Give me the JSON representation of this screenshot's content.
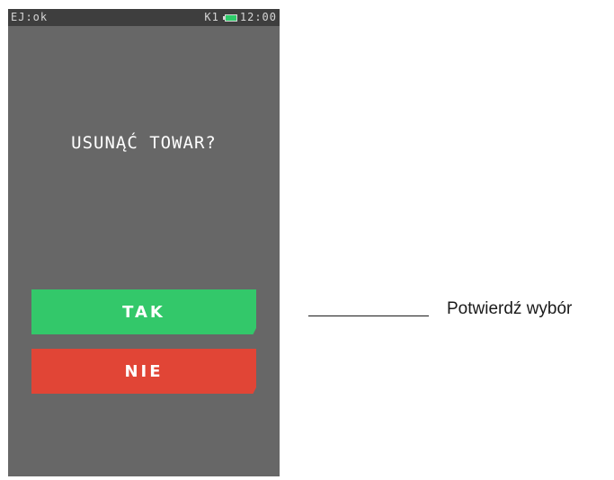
{
  "status_bar": {
    "left_text": "EJ:ok",
    "k_label": "K1",
    "battery_icon": "battery-charging-icon",
    "time": "12:00"
  },
  "dialog": {
    "question": "USUNĄĆ TOWAR?",
    "yes_label": "TAK",
    "no_label": "NIE"
  },
  "annotation": {
    "text": "Potwierdź wybór"
  },
  "colors": {
    "screen_bg": "#676767",
    "status_bar_bg": "#3e3e3e",
    "yes_button": "#33c86a",
    "no_button": "#e14536",
    "battery_fill": "#2ecc6a"
  }
}
